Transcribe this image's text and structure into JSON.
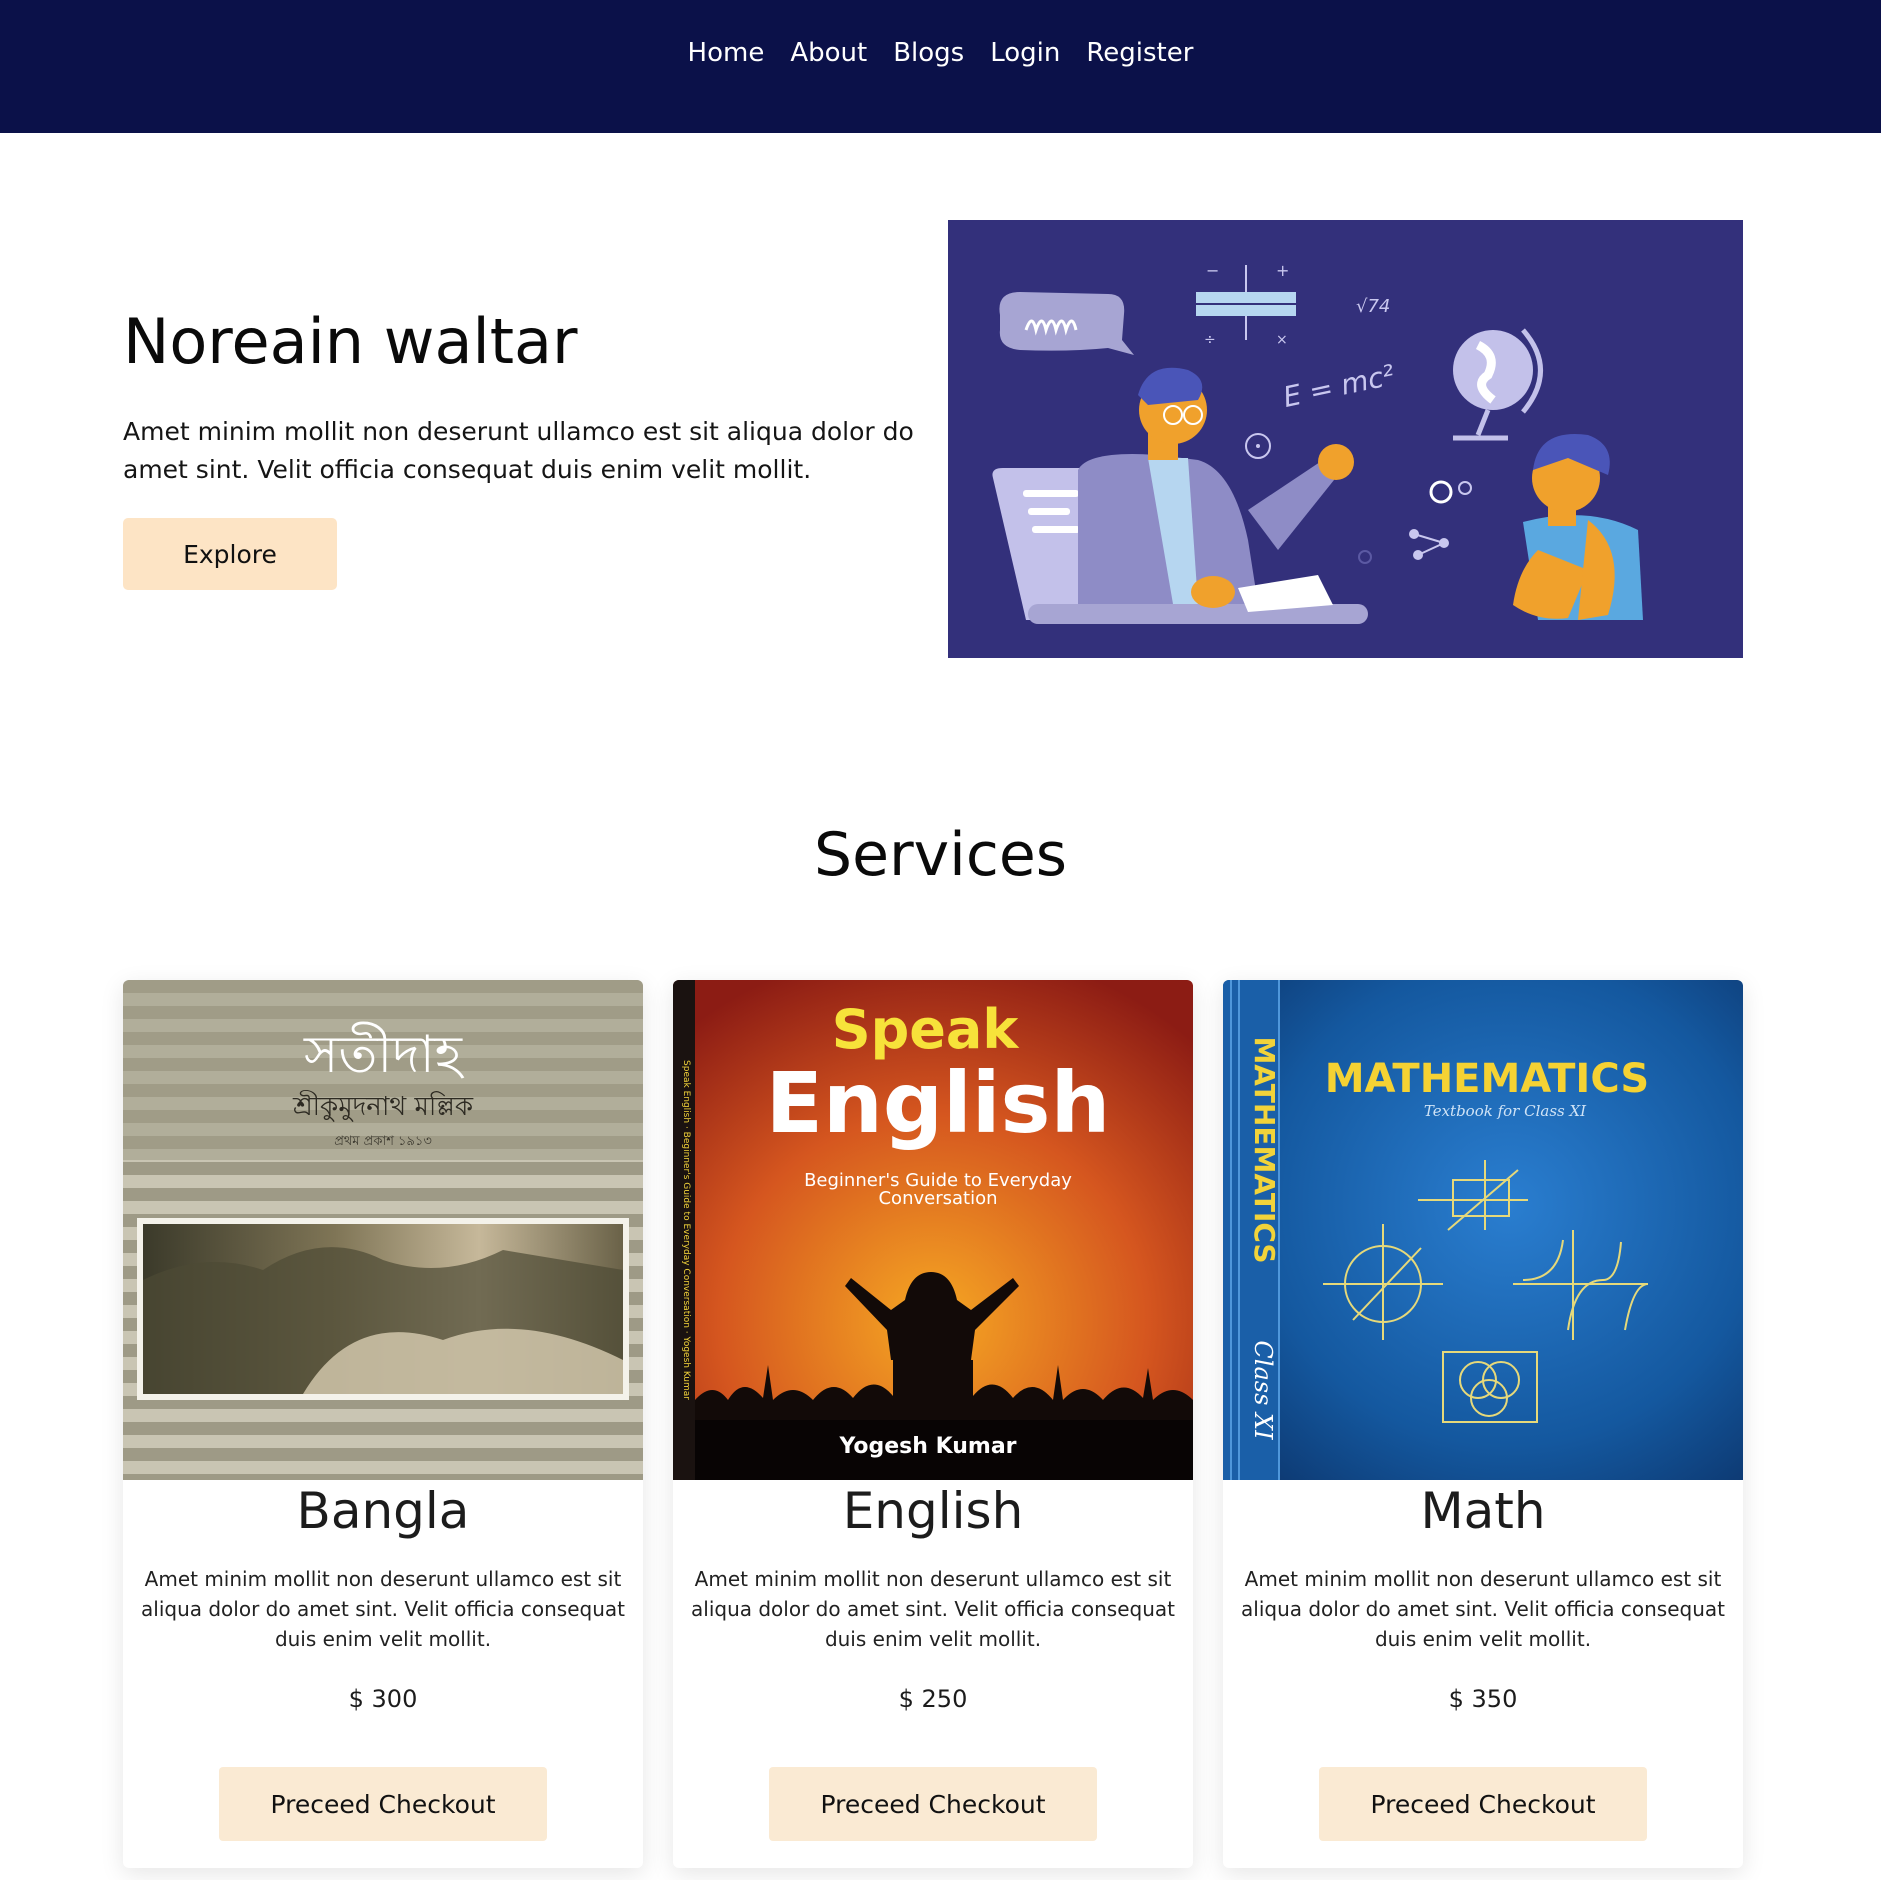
{
  "nav": {
    "items": [
      "Home",
      "About",
      "Blogs",
      "Login",
      "Register"
    ]
  },
  "hero": {
    "title": "Noreain waltar",
    "text": "Amet minim mollit non deserunt ullamco est sit aliqua dolor do amet sint. Velit officia consequat duis enim velit mollit.",
    "button": "Explore",
    "illustration_text": {
      "formula": "E = mc²",
      "sqrt": "√74"
    }
  },
  "services": {
    "title": "Services",
    "cards": [
      {
        "title": "Bangla",
        "description": "Amet minim mollit non deserunt ullamco est sit aliqua dolor do amet sint. Velit officia consequat duis enim velit mollit.",
        "price": "$ 300",
        "button": "Preceed Checkout",
        "cover": {
          "title": "সতীদাহ",
          "author": "শ্রীকুমুদনাথ মল্লিক",
          "edition": "প্রথম প্রকাশ ১৯১৩"
        }
      },
      {
        "title": "English",
        "description": "Amet minim mollit non deserunt ullamco est sit aliqua dolor do amet sint. Velit officia consequat duis enim velit mollit.",
        "price": "$ 250",
        "button": "Preceed Checkout",
        "cover": {
          "title_top": "Speak",
          "title_main": "English",
          "subtitle_1": "Beginner's Guide to Everyday",
          "subtitle_2": "Conversation",
          "author": "Yogesh Kumar",
          "spine": "Speak English · Beginner's Guide to Everyday Conversation · Yogesh Kumar"
        }
      },
      {
        "title": "Math",
        "description": "Amet minim mollit non deserunt ullamco est sit aliqua dolor do amet sint. Velit officia consequat duis enim velit mollit.",
        "price": "$ 350",
        "button": "Preceed Checkout",
        "cover": {
          "title": "MATHEMATICS",
          "subtitle": "Textbook for Class XI",
          "spine_title": "MATHEMATICS",
          "spine_class": "Class XI"
        }
      }
    ]
  },
  "colors": {
    "navbar": "#0b1149",
    "hero_button": "#fde4c5",
    "checkout_button": "#faead3",
    "illustration_bg": "#33307b"
  }
}
